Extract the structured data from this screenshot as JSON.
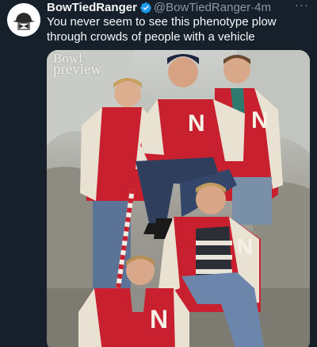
{
  "tweet": {
    "display_name": "BowTiedRanger",
    "handle": "@BowTiedRanger",
    "separator": "·",
    "time": "4m",
    "more": "···",
    "text": "You never seem to see this phenotype plow through crowds of people with a vehicle",
    "avatar_icon": "bowtie-ranger-hat-icon",
    "verified_icon": "verified-badge-icon"
  },
  "media": {
    "watermark_line1": "Bowl",
    "watermark_line2": "preview",
    "jacket_letter": "N"
  },
  "colors": {
    "background": "#15202b",
    "text_primary": "#f7f9f9",
    "text_secondary": "#8b98a5",
    "verified_blue": "#1d9bf0",
    "jacket_red": "#c8202f",
    "sleeve_cream": "#e9e2d2"
  }
}
